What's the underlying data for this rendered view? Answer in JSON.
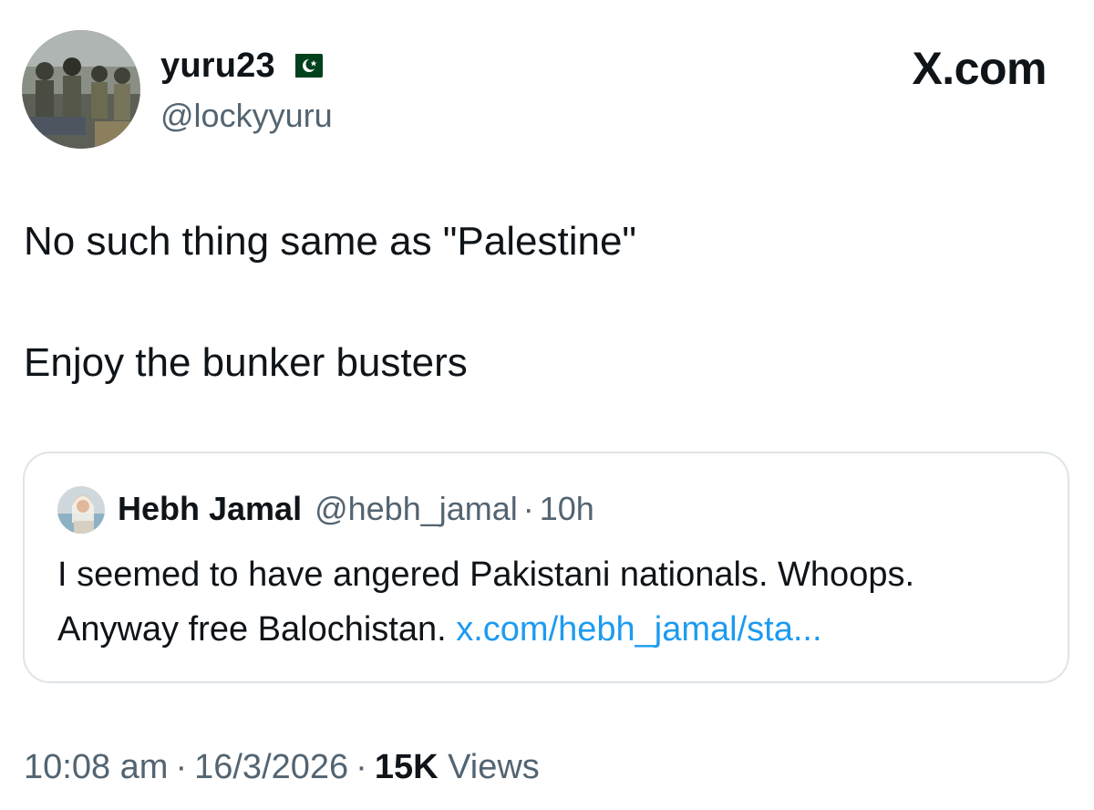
{
  "author": {
    "display_name": "yuru23",
    "handle": "@lockyyuru",
    "flag_icon": "pakistan-flag-icon",
    "avatar": "soldiers-group-photo"
  },
  "brand": {
    "label": "X.com"
  },
  "tweet": {
    "line1": "No such thing same as \"Palestine\"",
    "line2": "Enjoy the bunker busters"
  },
  "quote": {
    "display_name": "Hebh Jamal",
    "handle": "@hebh_jamal",
    "separator": "·",
    "time": "10h",
    "line1": "I seemed to have angered Pakistani nationals. Whoops.",
    "line2_text": "Anyway free Balochistan.",
    "link": "x.com/hebh_jamal/sta..."
  },
  "meta": {
    "time": "10:08 am",
    "separator": "·",
    "date": "16/3/2026",
    "views_count": "15K",
    "views_label": "Views"
  },
  "colors": {
    "text": "#0f1419",
    "secondary": "#536471",
    "link": "#1d9bf0",
    "border": "#dfe4e8",
    "flag_green": "#01411c"
  }
}
